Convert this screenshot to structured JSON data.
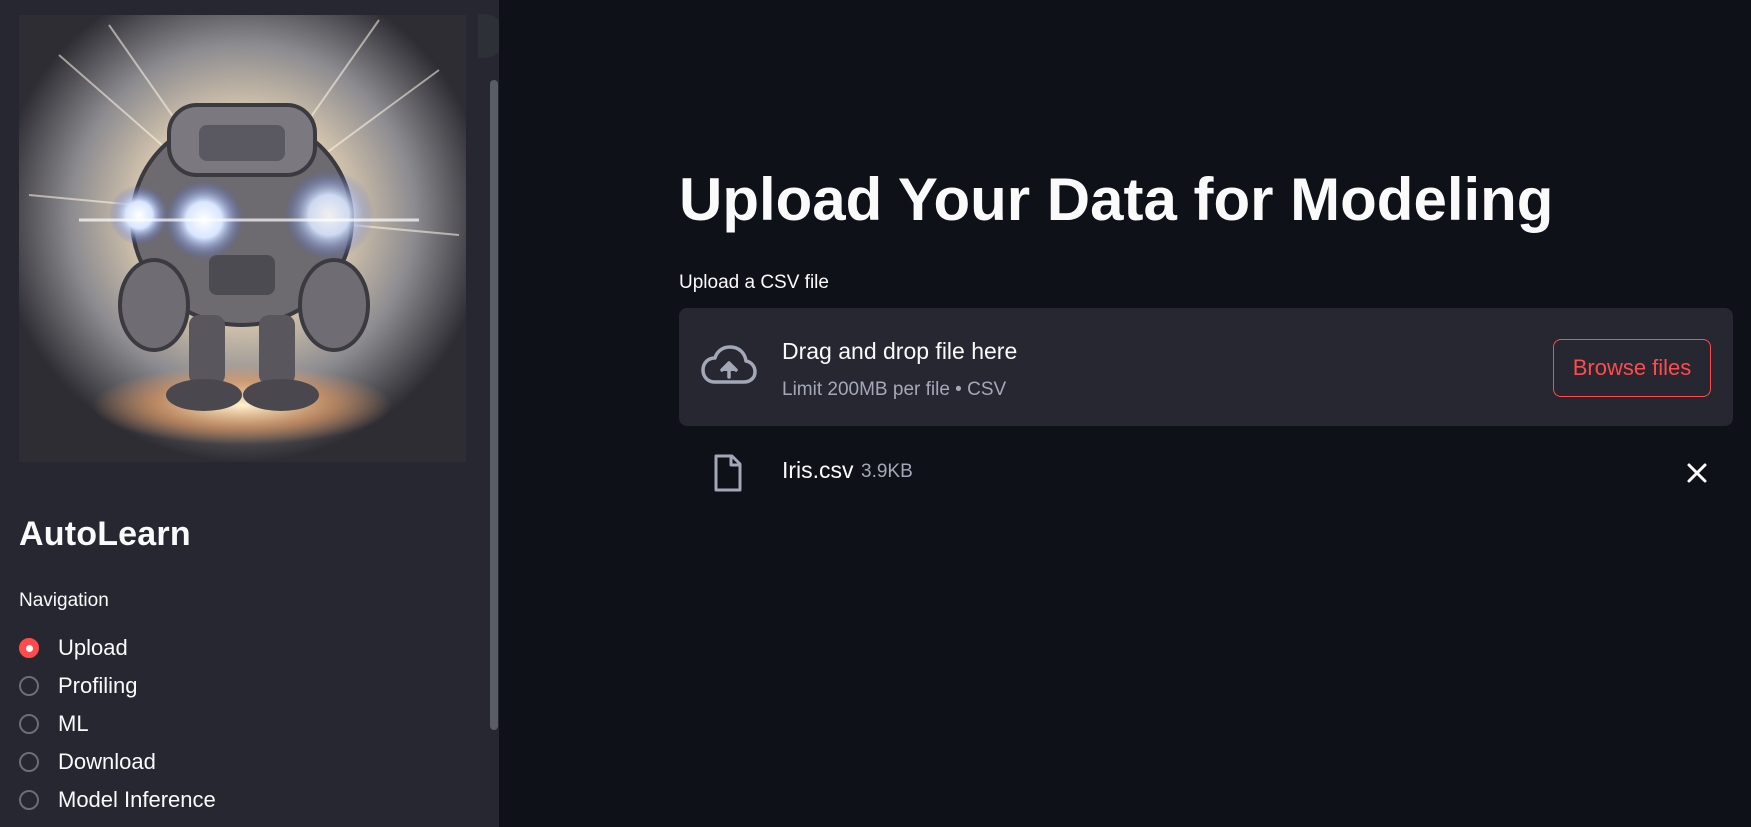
{
  "sidebar": {
    "title": "AutoLearn",
    "navigation_label": "Navigation",
    "nav_items": [
      {
        "label": "Upload",
        "selected": true
      },
      {
        "label": "Profiling",
        "selected": false
      },
      {
        "label": "ML",
        "selected": false
      },
      {
        "label": "Download",
        "selected": false
      },
      {
        "label": "Model Inference",
        "selected": false
      }
    ],
    "image_icon": "robot-illustration"
  },
  "main": {
    "title": "Upload Your Data for Modeling",
    "uploader": {
      "label": "Upload a CSV file",
      "drop_text": "Drag and drop file here",
      "limit_text": "Limit 200MB per file • CSV",
      "browse_label": "Browse files",
      "icon": "cloud-upload-icon"
    },
    "uploaded_file": {
      "name": "Iris.csv",
      "size": "3.9KB",
      "icon": "file-icon",
      "remove_icon": "close-icon"
    }
  },
  "colors": {
    "accent": "#ff4b4b",
    "background": "#0e1117",
    "sidebar": "#262730",
    "dropzone": "#262730",
    "muted_text": "#a3a8b8"
  }
}
